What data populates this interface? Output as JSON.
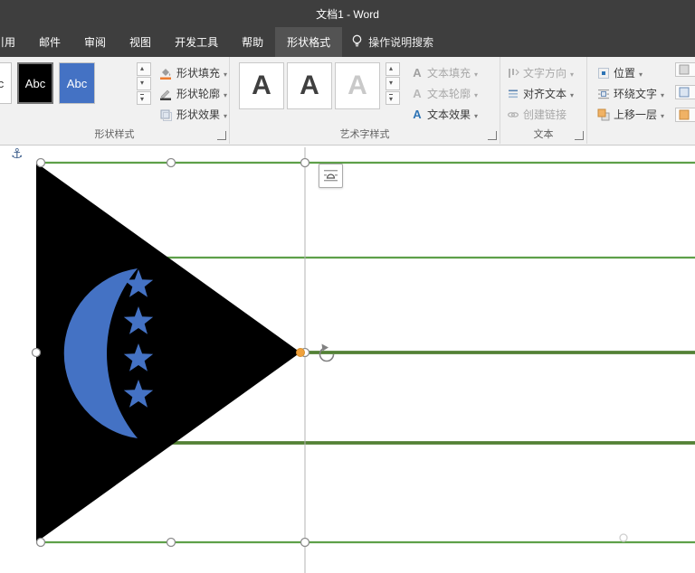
{
  "colors": {
    "titlebar_bg": "#3e3e3e",
    "ribbon_bg": "#f1f1f1",
    "accent_blue": "#4472c4",
    "flag_black": "#000000",
    "stripe_green": "#5ea049",
    "stripe_green_dark": "#538135",
    "handle_border": "#8c8c8c",
    "adjust_orange": "#f0a13c"
  },
  "title_bar": {
    "title": "文档1 - Word"
  },
  "tabs": {
    "items": [
      {
        "label": "引用"
      },
      {
        "label": "邮件"
      },
      {
        "label": "审阅"
      },
      {
        "label": "视图"
      },
      {
        "label": "开发工具"
      },
      {
        "label": "帮助"
      },
      {
        "label": "形状格式"
      }
    ],
    "active_tab": "形状格式",
    "search_label": "操作说明搜索"
  },
  "ribbon": {
    "shape_styles": {
      "label": "形状样式",
      "presets": [
        "Abc",
        "Abc",
        "Abc"
      ],
      "fill": "形状填充",
      "outline": "形状轮廓",
      "effects": "形状效果"
    },
    "wordart": {
      "label": "艺术字样式",
      "letters": [
        "A",
        "A",
        "A"
      ],
      "text_fill": "文本填充",
      "text_outline": "文本轮廓",
      "text_effects": "文本效果"
    },
    "text": {
      "label": "文本",
      "direction": "文字方向",
      "align": "对齐文本",
      "link": "创建链接"
    },
    "arrange": {
      "position": "位置",
      "wrap": "环绕文字",
      "bring_forward": "上移一层"
    }
  },
  "canvas": {
    "selected_shape": "flag-triangle-with-crescent-and-stars",
    "stars_count": 4,
    "stripes_count": 5
  }
}
